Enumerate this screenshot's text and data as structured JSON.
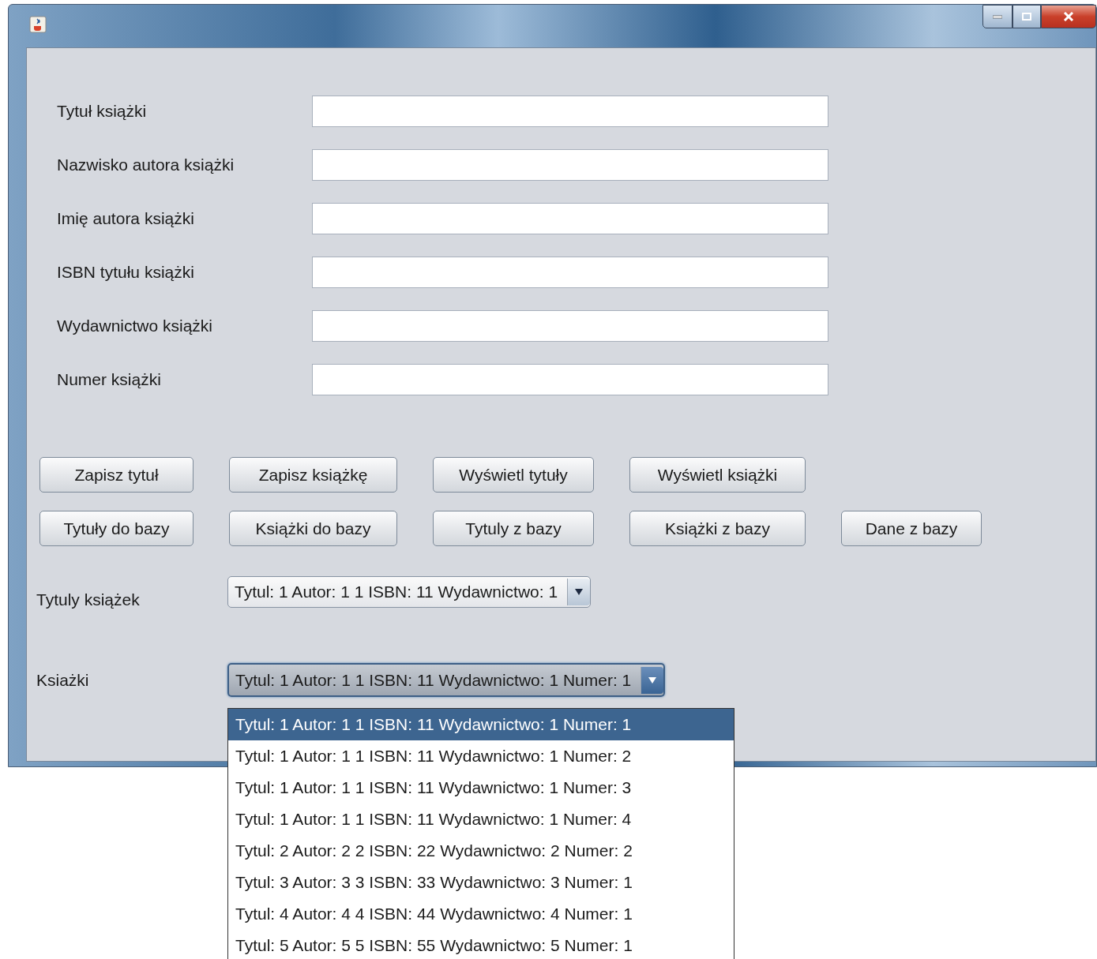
{
  "fields": [
    {
      "label": "Tytuł książki"
    },
    {
      "label": "Nazwisko autora książki"
    },
    {
      "label": "Imię autora książki"
    },
    {
      "label": "ISBN tytułu książki"
    },
    {
      "label": "Wydawnictwo książki"
    },
    {
      "label": "Numer książki"
    }
  ],
  "button_rows": [
    [
      "Zapisz tytuł",
      "Zapisz książkę",
      "Wyświetl tytuły",
      "Wyświetl książki"
    ],
    [
      "Tytuły do bazy",
      "Książki do bazy",
      "Tytuly z bazy",
      "Książki z bazy",
      "Dane z bazy"
    ]
  ],
  "combos": [
    {
      "label": "Tytuly książek",
      "value": "Tytul: 1 Autor: 1 1 ISBN: 11 Wydawnictwo: 1",
      "expanded": false
    },
    {
      "label": "Ksiażki",
      "value": "Tytul: 1 Autor: 1 1 ISBN: 11 Wydawnictwo: 1 Numer: 1",
      "expanded": true
    }
  ],
  "dropdown_items": [
    {
      "text": "Tytul: 1 Autor: 1 1 ISBN: 11 Wydawnictwo: 1 Numer: 1",
      "selected": true
    },
    {
      "text": "Tytul: 1 Autor: 1 1 ISBN: 11 Wydawnictwo: 1 Numer: 2",
      "selected": false
    },
    {
      "text": "Tytul: 1 Autor: 1 1 ISBN: 11 Wydawnictwo: 1 Numer: 3",
      "selected": false
    },
    {
      "text": "Tytul: 1 Autor: 1 1 ISBN: 11 Wydawnictwo: 1 Numer: 4",
      "selected": false
    },
    {
      "text": "Tytul: 2 Autor: 2 2 ISBN: 22 Wydawnictwo: 2 Numer: 2",
      "selected": false
    },
    {
      "text": "Tytul: 3 Autor: 3 3 ISBN: 33 Wydawnictwo: 3 Numer: 1",
      "selected": false
    },
    {
      "text": "Tytul: 4 Autor: 4 4 ISBN: 44 Wydawnictwo: 4 Numer: 1",
      "selected": false
    },
    {
      "text": "Tytul: 5 Autor: 5 5 ISBN: 55 Wydawnictwo: 5 Numer: 1",
      "selected": false
    }
  ]
}
